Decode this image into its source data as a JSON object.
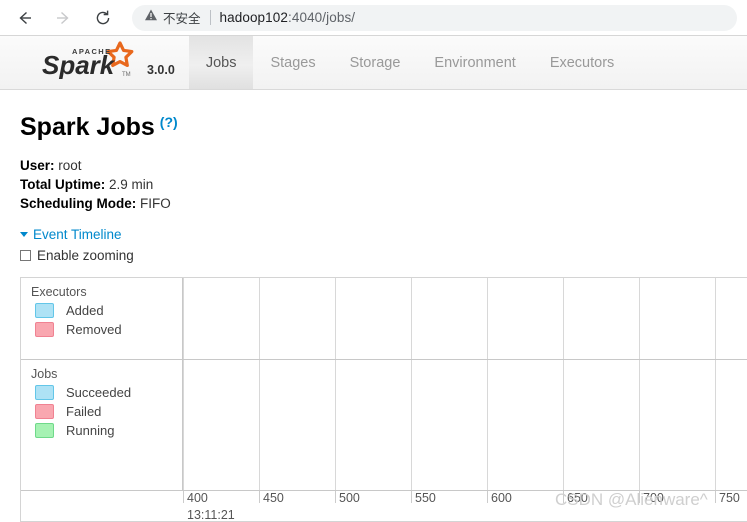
{
  "browser": {
    "back_icon": "arrow-left-icon",
    "forward_icon": "arrow-right-icon",
    "reload_icon": "reload-icon",
    "security_icon": "warning-triangle-icon",
    "security_label": "不安全",
    "url_host": "hadoop102",
    "url_path": ":4040/jobs/",
    "url_full": "hadoop102:4040/jobs/"
  },
  "navbar": {
    "brand_apache": "APACHE",
    "brand_name": "Spark",
    "version": "3.0.0",
    "tabs": [
      {
        "label": "Jobs",
        "active": true
      },
      {
        "label": "Stages",
        "active": false
      },
      {
        "label": "Storage",
        "active": false
      },
      {
        "label": "Environment",
        "active": false
      },
      {
        "label": "Executors",
        "active": false
      }
    ]
  },
  "page": {
    "title": "Spark Jobs",
    "help_link": "(?)",
    "summary": [
      {
        "key": "User:",
        "value": "root"
      },
      {
        "key": "Total Uptime:",
        "value": "2.9 min"
      },
      {
        "key": "Scheduling Mode:",
        "value": "FIFO"
      }
    ],
    "timeline_toggle": "Event Timeline",
    "zoom_label": "Enable zooming",
    "zoom_checked": false
  },
  "timeline": {
    "groups": [
      {
        "title": "Executors",
        "items": [
          {
            "label": "Added",
            "color": "#aee2f5",
            "border": "#63c6e8"
          },
          {
            "label": "Removed",
            "color": "#f9a7b0",
            "border": "#f08292"
          }
        ]
      },
      {
        "title": "Jobs",
        "items": [
          {
            "label": "Succeeded",
            "color": "#aee2f5",
            "border": "#63c6e8"
          },
          {
            "label": "Failed",
            "color": "#f9a7b0",
            "border": "#f08292"
          },
          {
            "label": "Running",
            "color": "#a6f2b3",
            "border": "#6fd98a"
          }
        ]
      }
    ],
    "axis_ticks": [
      "400",
      "450",
      "500",
      "550",
      "600",
      "650",
      "700",
      "750"
    ],
    "axis_time": "13:11:21"
  },
  "watermark": "CSDN @Alienware^"
}
